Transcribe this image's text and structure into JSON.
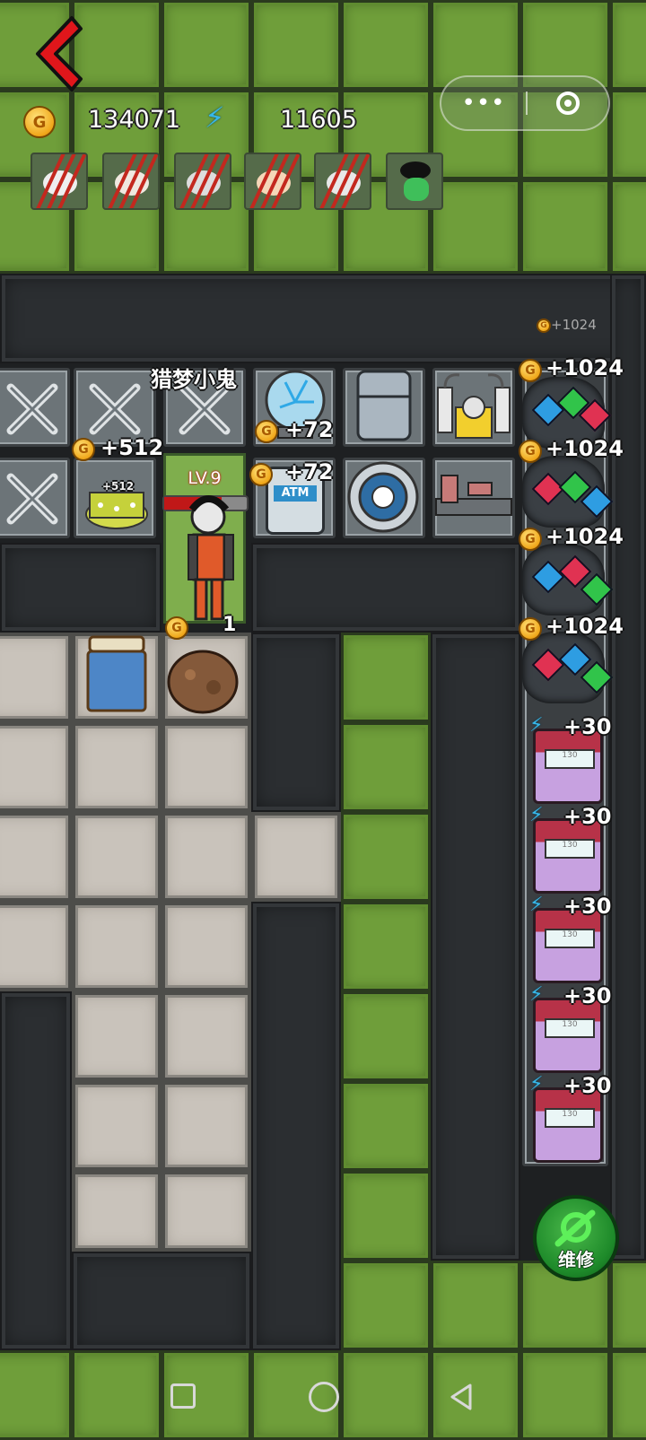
{
  "hud": {
    "gold_value": "134071",
    "energy_value": "11605",
    "coin_letter": "G"
  },
  "enemies": [
    "claw-monster-1",
    "claw-monster-2",
    "claw-monster-3",
    "claw-monster-4",
    "claw-monster-5",
    "green-ghost"
  ],
  "room": {
    "name": "猎梦小鬼",
    "level": "LV.9",
    "occupant_value": "1"
  },
  "gains": {
    "faint_top": "+1024",
    "bed_gold": "+512",
    "bed_small": "+512",
    "orb_gold": "+72",
    "atm_gold": "+72",
    "ore_gold": [
      "+1024",
      "+1024",
      "+1024",
      "+1024"
    ],
    "machine_energy": [
      "+30",
      "+30",
      "+30",
      "+30",
      "+30"
    ]
  },
  "repair_button": {
    "label": "维修"
  },
  "atm_label": "ATM",
  "machine_screen": "130",
  "colors": {
    "grass": "#6f9e3a",
    "wall": "#2b2e31",
    "floor": "#c9c3bb",
    "back_red": "#e0161b",
    "repair_green": "#1e8a2a"
  }
}
